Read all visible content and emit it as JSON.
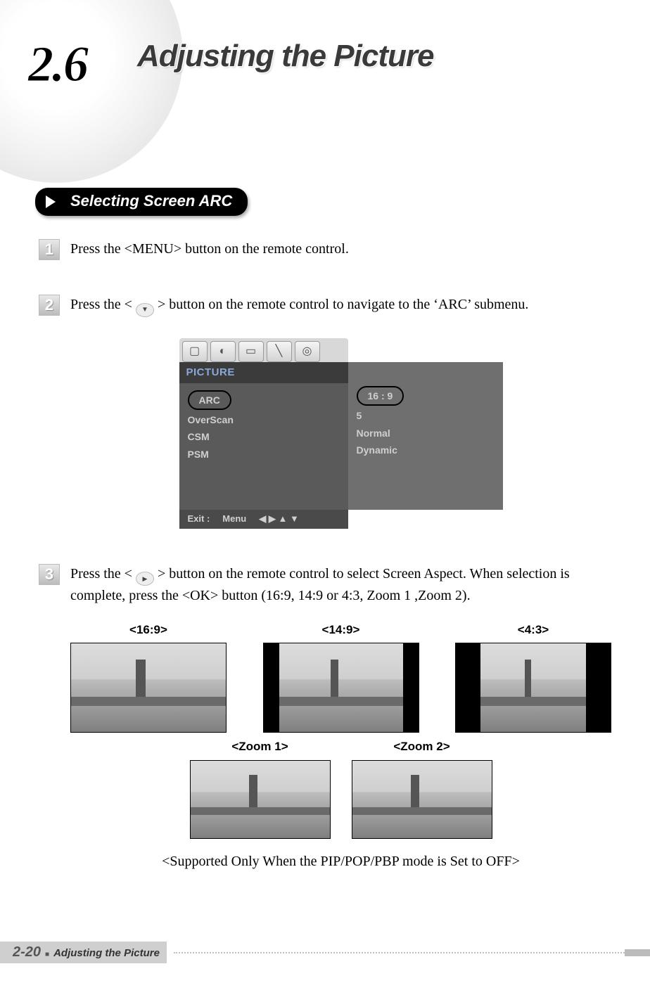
{
  "header": {
    "section_number": "2.6",
    "title": "Adjusting the Picture"
  },
  "subheading": "Selecting Screen ARC",
  "steps": {
    "s1": {
      "num": "1",
      "text_a": "Press the <MENU> button on the remote control."
    },
    "s2": {
      "num": "2",
      "text_a": "Press the < ",
      "text_b": " > button on the remote control to navigate to the ‘ARC’ submenu."
    },
    "s3": {
      "num": "3",
      "text_a": "Press the < ",
      "text_b": " > button on the remote control to select Screen Aspect. When selection is complete, press the <OK> button (16:9, 14:9 or 4:3, Zoom 1 ,Zoom 2)."
    }
  },
  "osd": {
    "heading": "PICTURE",
    "left_items": [
      "ARC",
      "OverScan",
      "CSM",
      "PSM"
    ],
    "right_items": [
      "16 : 9",
      "5",
      "Normal",
      "Dynamic"
    ],
    "footer_exit": "Exit :",
    "footer_menu": "Menu",
    "footer_arrows": "◀ ▶ ▲ ▼"
  },
  "aspects": {
    "row1": [
      {
        "label": "<16:9>"
      },
      {
        "label": "<14:9>"
      },
      {
        "label": "<4:3>"
      }
    ],
    "row2": [
      {
        "label": "<Zoom 1>"
      },
      {
        "label": "<Zoom 2>"
      }
    ]
  },
  "note": "<Supported Only When the PIP/POP/PBP mode is Set to OFF>",
  "footer": {
    "page": "2-20",
    "title": "Adjusting the Picture"
  }
}
